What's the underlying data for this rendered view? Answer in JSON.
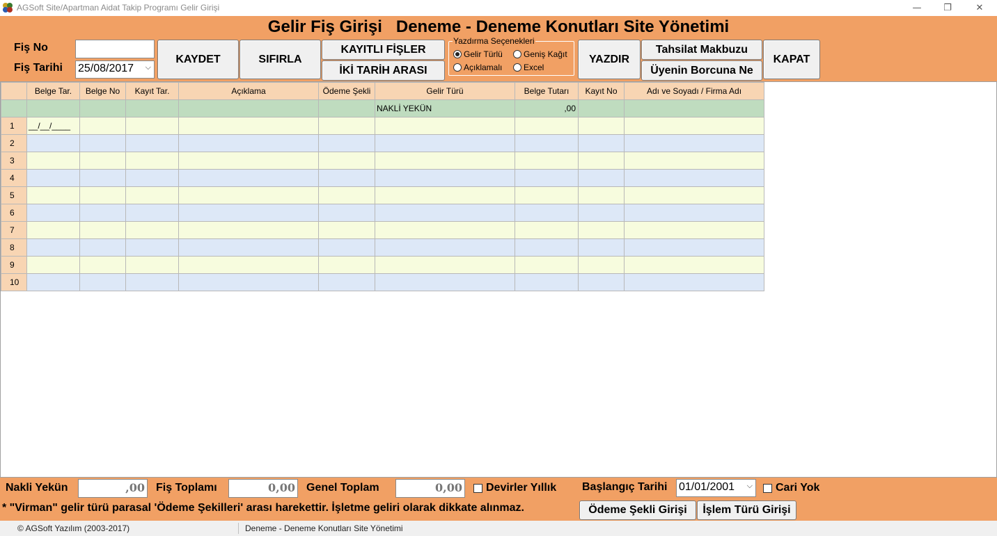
{
  "window": {
    "title": "AGSoft Site/Apartman Aidat Takip Programı Gelir Girişi",
    "minimize": "—",
    "maximize": "❐",
    "close": "✕"
  },
  "header": {
    "title": "Gelir Fiş Girişi   Deneme - Deneme Konutları Site Yönetimi",
    "fis_no_label": "Fiş No",
    "fis_no_value": "",
    "fis_tarihi_label": "Fiş Tarihi",
    "fis_tarihi_value": "25/08/2017",
    "buttons": {
      "kaydet": "KAYDET",
      "sifirla": "SIFIRLA",
      "kayitli_fisler": "KAYITLI FİŞLER",
      "iki_tarih_arasi": "İKİ TARİH ARASI",
      "yazdir": "YAZDIR",
      "tahsilat_makbuzu": "Tahsilat Makbuzu",
      "uyenin_borcuna_ne": "Üyenin Borcuna Ne",
      "kapat": "KAPAT"
    },
    "print_options": {
      "title": "Yazdırma Seçenekleri",
      "gelir_turlu": "Gelir Türlü",
      "genis_kagit": "Geniş Kağıt",
      "aciklamali": "Açıklamalı",
      "excel": "Excel",
      "selected": "Gelir Türlü"
    }
  },
  "grid": {
    "columns": [
      "Belge Tar.",
      "Belge No",
      "Kayıt Tar.",
      "Açıklama",
      "Ödeme Şekli",
      "Gelir Türü",
      "Belge Tutarı",
      "Kayıt No",
      "Adı ve Soyadı / Firma Adı"
    ],
    "nakli_row": {
      "gelir_turu": "NAKLİ YEKÜN",
      "belge_tutari": ",00"
    },
    "date_mask": "__/__/____",
    "rows": [
      "1",
      "2",
      "3",
      "4",
      "5",
      "6",
      "7",
      "8",
      "9",
      "10"
    ]
  },
  "footer": {
    "nakli_yekun_label": "Nakli Yekün",
    "nakli_yekun_value": ",00",
    "fis_toplami_label": "Fiş Toplamı",
    "fis_toplami_value": "0,00",
    "genel_toplam_label": "Genel Toplam",
    "genel_toplam_value": "0,00",
    "devirler_yillik": "Devirler Yıllık",
    "baslangic_tarihi_label": "Başlangıç Tarihi",
    "baslangic_tarihi_value": "01/01/2001",
    "cari_yok": "Cari Yok",
    "note": "* \"Virman\" gelir türü parasal 'Ödeme Şekilleri' arası harekettir. İşletme geliri olarak dikkate alınmaz.",
    "odeme_sekli_girisi": "Ödeme Şekli Girişi",
    "islem_turu_girisi": "İşlem Türü Girişi"
  },
  "status": {
    "copyright": "© AGSoft Yazılım (2003-2017)",
    "company": "Deneme - Deneme Konutları Site Yönetimi"
  },
  "colors": {
    "header_bg": "#f1a064",
    "grid_header": "#f8d5b3",
    "nakli_row": "#bfdcbf",
    "row_odd": "#f7fcde",
    "row_even": "#dde8f7"
  }
}
